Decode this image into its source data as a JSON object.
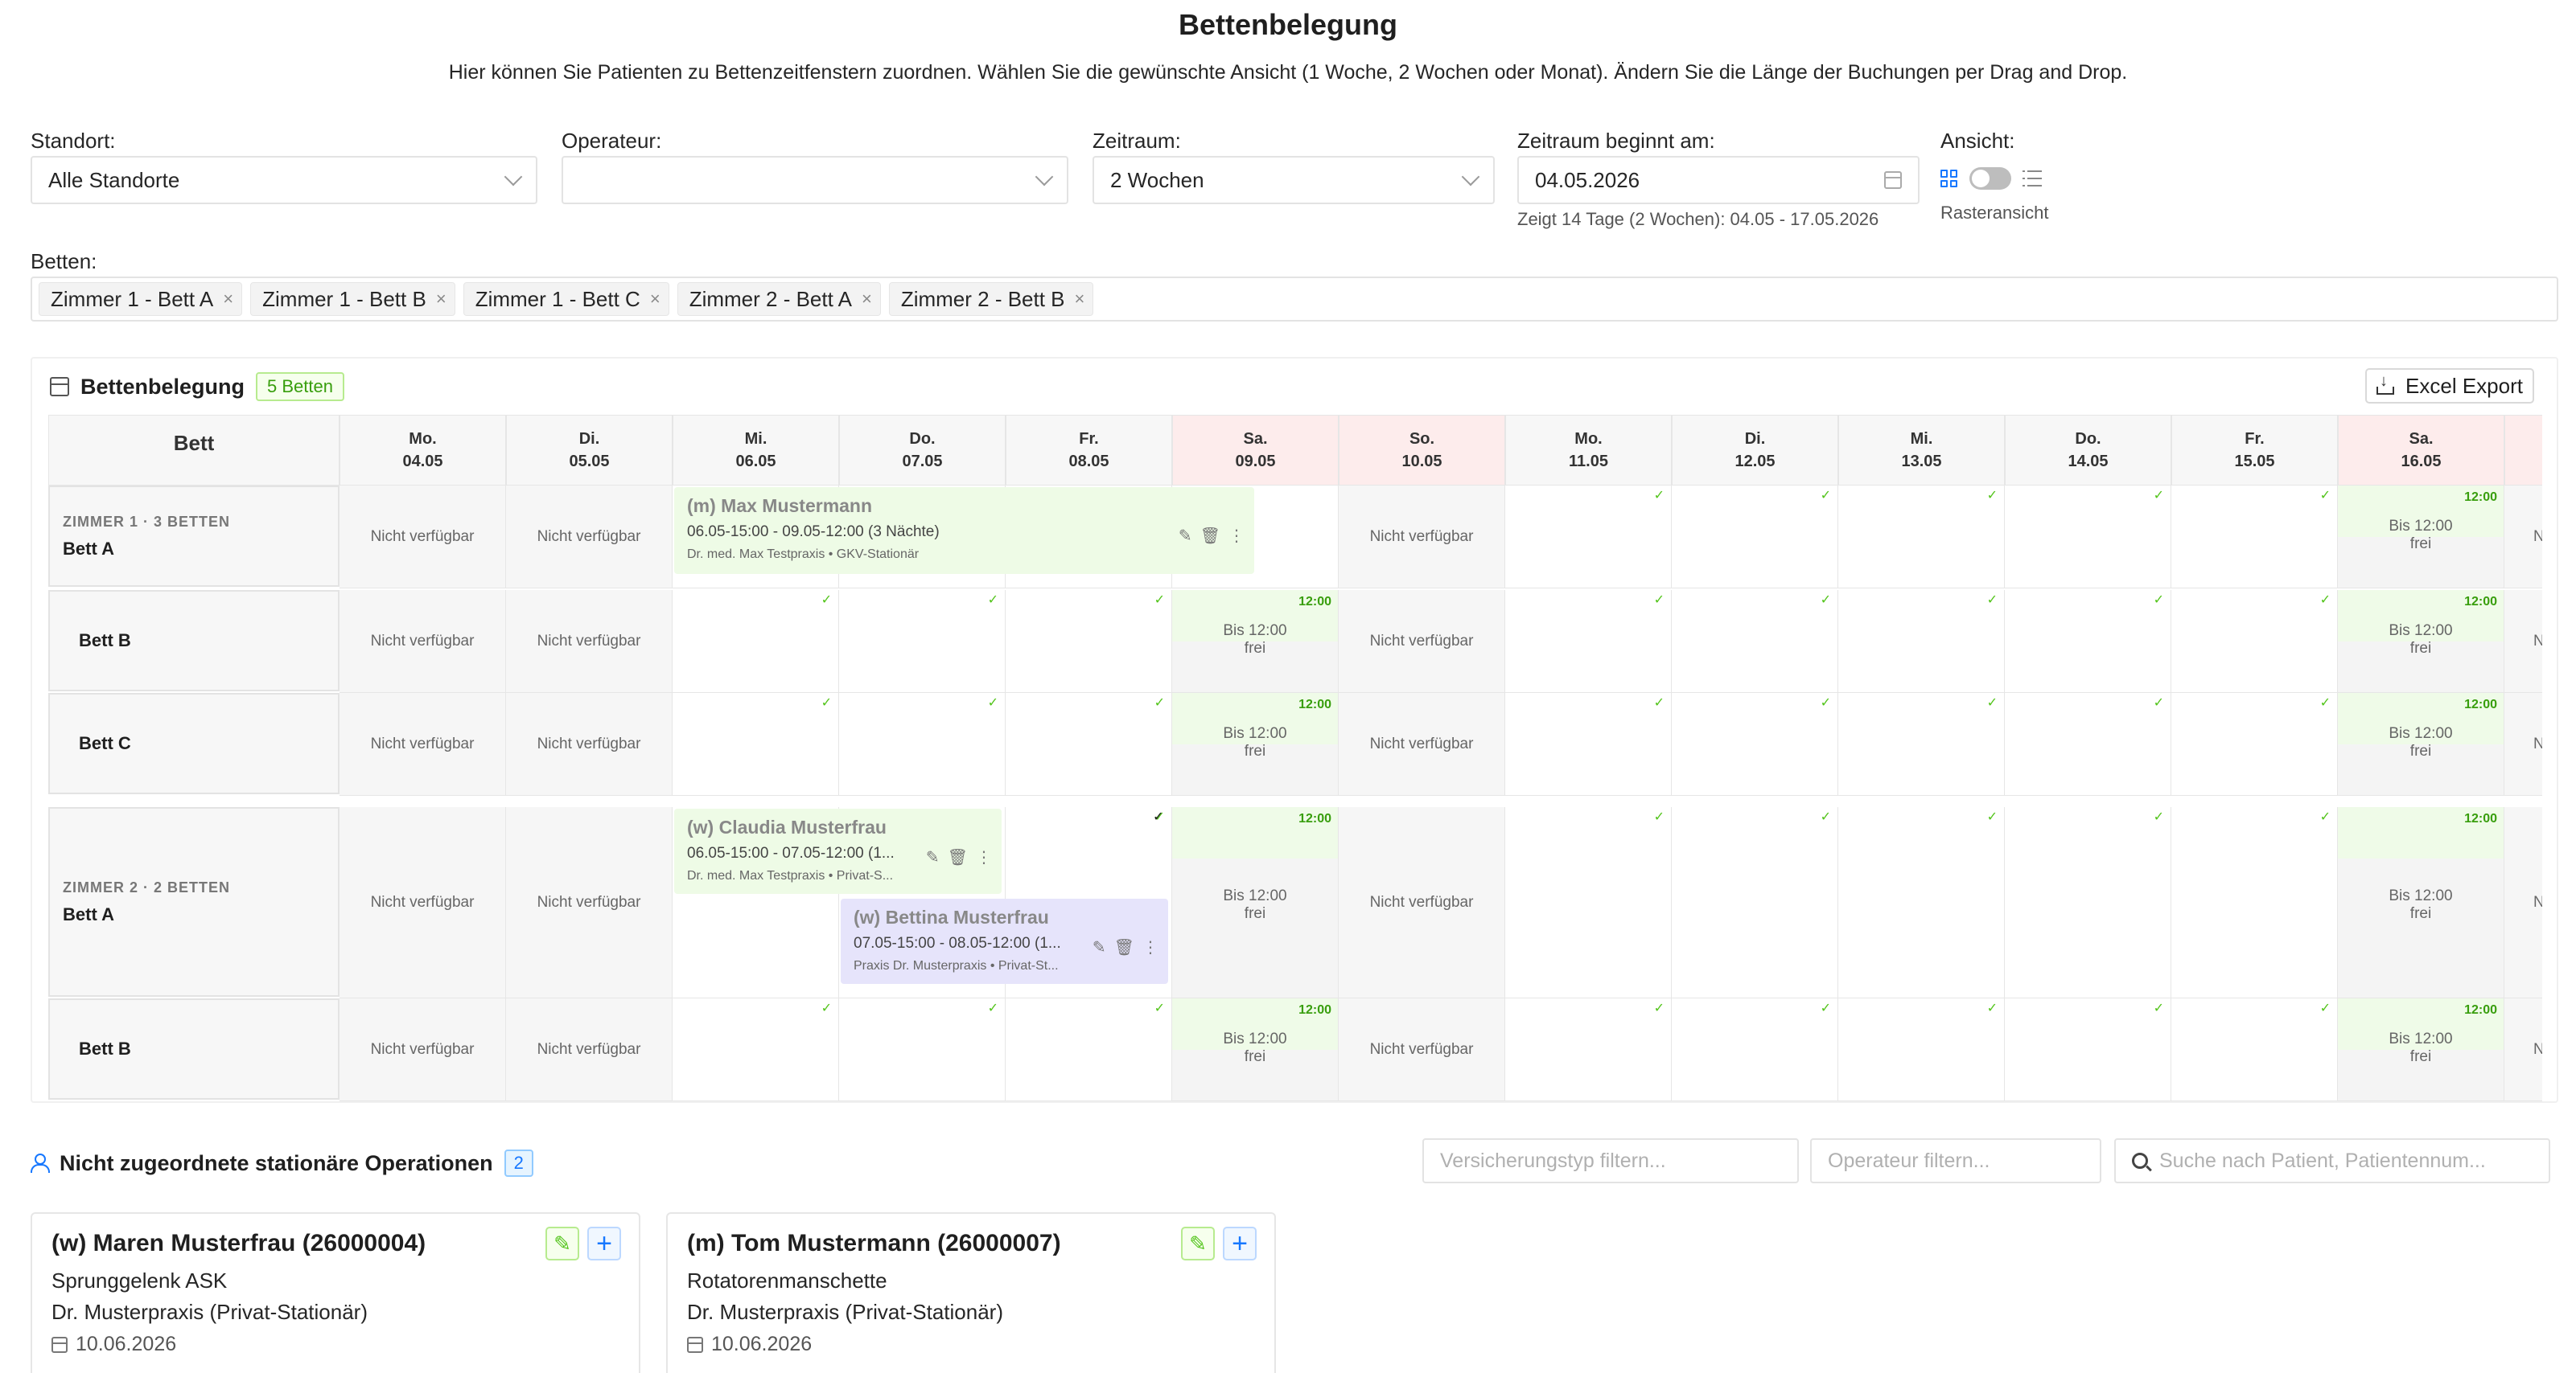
{
  "page": {
    "title": "Bettenbelegung",
    "description": "Hier können Sie Patienten zu Bettenzeitfenstern zuordnen. Wählen Sie die gewünschte Ansicht (1 Woche, 2 Wochen oder Monat). Ändern Sie die Länge der Buchungen per Drag and Drop."
  },
  "filters": {
    "standort": {
      "label": "Standort:",
      "value": "Alle Standorte"
    },
    "operateur": {
      "label": "Operateur:",
      "value": ""
    },
    "zeitraum": {
      "label": "Zeitraum:",
      "value": "2 Wochen"
    },
    "beginn": {
      "label": "Zeitraum beginnt am:",
      "value": "04.05.2026",
      "hint": "Zeigt 14 Tage (2 Wochen): 04.05 - 17.05.2026"
    },
    "ansicht": {
      "label": "Ansicht:",
      "mode": "Rasteransicht",
      "toggle_on": false
    },
    "betten": {
      "label": "Betten:",
      "tags": [
        "Zimmer 1 - Bett A",
        "Zimmer 1 - Bett B",
        "Zimmer 1 - Bett C",
        "Zimmer 2 - Bett A",
        "Zimmer 2 - Bett B"
      ]
    }
  },
  "board": {
    "title": "Bettenbelegung",
    "badge": "5 Betten",
    "export_label": "Excel Export",
    "bed_header": "Bett",
    "days": [
      {
        "dow": "Mo.",
        "date": "04.05",
        "weekend": false
      },
      {
        "dow": "Di.",
        "date": "05.05",
        "weekend": false
      },
      {
        "dow": "Mi.",
        "date": "06.05",
        "weekend": false
      },
      {
        "dow": "Do.",
        "date": "07.05",
        "weekend": false
      },
      {
        "dow": "Fr.",
        "date": "08.05",
        "weekend": false
      },
      {
        "dow": "Sa.",
        "date": "09.05",
        "weekend": true
      },
      {
        "dow": "So.",
        "date": "10.05",
        "weekend": true
      },
      {
        "dow": "Mo.",
        "date": "11.05",
        "weekend": false
      },
      {
        "dow": "Di.",
        "date": "12.05",
        "weekend": false
      },
      {
        "dow": "Mi.",
        "date": "13.05",
        "weekend": false
      },
      {
        "dow": "Do.",
        "date": "14.05",
        "weekend": false
      },
      {
        "dow": "Fr.",
        "date": "15.05",
        "weekend": false
      },
      {
        "dow": "Sa.",
        "date": "16.05",
        "weekend": true
      },
      {
        "dow": "",
        "date": "",
        "weekend": true
      }
    ],
    "rows": [
      {
        "room": "ZIMMER 1 · 3 BETTEN",
        "bed": "Bett A",
        "cells": [
          "na",
          "na",
          "bk",
          "bk",
          "bk",
          "bk",
          "na",
          "ok",
          "ok",
          "ok",
          "ok",
          "ok",
          "frei",
          "na"
        ]
      },
      {
        "room": "",
        "bed": "Bett B",
        "cells": [
          "na",
          "na",
          "ok",
          "ok",
          "ok",
          "frei",
          "na",
          "ok",
          "ok",
          "ok",
          "ok",
          "ok",
          "frei",
          "na"
        ]
      },
      {
        "room": "",
        "bed": "Bett C",
        "cells": [
          "na",
          "na",
          "ok",
          "ok",
          "ok",
          "frei",
          "na",
          "ok",
          "ok",
          "ok",
          "ok",
          "ok",
          "frei",
          "na"
        ]
      },
      {
        "room": "ZIMMER 2 · 2 BETTEN",
        "bed": "Bett A",
        "cells": [
          "na",
          "na",
          "bk",
          "bk",
          "ok",
          "frei",
          "na",
          "ok",
          "ok",
          "ok",
          "ok",
          "ok",
          "frei",
          "na"
        ]
      },
      {
        "room": "",
        "bed": "Bett B",
        "cells": [
          "na",
          "na",
          "ok",
          "ok",
          "ok",
          "frei",
          "na",
          "ok",
          "ok",
          "ok",
          "ok",
          "ok",
          "frei",
          "na"
        ]
      }
    ],
    "cell_texts": {
      "na": "Nicht verfügbar",
      "na_clipped": "N",
      "t12": "12:00",
      "bis": "Bis 12:00",
      "frei": "frei",
      "check": "✓"
    },
    "bookings": [
      {
        "name": "(m) Max Mustermann",
        "time": "06.05-15:00 - 09.05-12:00 (3 Nächte)",
        "sub": "Dr. med. Max Testpraxis • GKV-Stationär",
        "color": "#eefbe6"
      },
      {
        "name": "(w) Claudia Musterfrau",
        "time": "06.05-15:00 - 07.05-12:00 (1...",
        "sub": "Dr. med. Max Testpraxis • Privat-S...",
        "color": "#eefbe6"
      },
      {
        "name": "(w) Bettina Musterfrau",
        "time": "07.05-15:00 - 08.05-12:00 (1...",
        "sub": "Praxis Dr. Musterpraxis • Privat-St...",
        "color": "#e6e4fb"
      }
    ]
  },
  "unassigned": {
    "title": "Nicht zugeordnete stationäre Operationen",
    "count": "2",
    "filter_insurance": "Versicherungstyp filtern...",
    "filter_operator": "Operateur filtern...",
    "search_placeholder": "Suche nach Patient, Patientennum...",
    "cards": [
      {
        "title": "(w) Maren Musterfrau (26000004)",
        "procedure": "Sprunggelenk ASK",
        "practice": "Dr. Musterpraxis (Privat-Stationär)",
        "date": "10.06.2026"
      },
      {
        "title": "(m) Tom Mustermann (26000007)",
        "procedure": "Rotatorenmanschette",
        "practice": "Dr. Musterpraxis (Privat-Stationär)",
        "date": "10.06.2026"
      }
    ]
  },
  "colors": {
    "accent": "#1677ff",
    "success": "#52c41a",
    "weekend_header": "#fdecec",
    "booking_green": "#eefbe6",
    "booking_purple": "#e6e4fb"
  }
}
